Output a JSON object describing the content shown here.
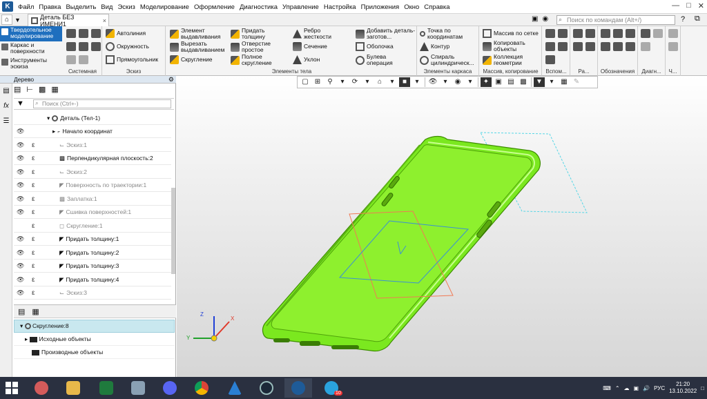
{
  "menu": {
    "items": [
      "Файл",
      "Правка",
      "Выделить",
      "Вид",
      "Эскиз",
      "Моделирование",
      "Оформление",
      "Диагностика",
      "Управление",
      "Настройка",
      "Приложения",
      "Окно",
      "Справка"
    ]
  },
  "tab": {
    "title": "Деталь БЕЗ ИМЕНИ1",
    "close": "×"
  },
  "command_search": {
    "placeholder": "Поиск по командам (Alt+/)"
  },
  "modes": [
    "Твердотельное моделирование",
    "Каркас и поверхности",
    "Инструменты эскиза"
  ],
  "ribbon": {
    "system_label": "Системная",
    "sketch": {
      "label": "Эскиз",
      "b1": "Автолиния",
      "b2": "Окружность",
      "b3": "Прямоугольник"
    },
    "body": {
      "label": "Элементы тела",
      "b1": "Элемент выдавливания",
      "b2": "Вырезать выдавливанием",
      "b3": "Скругление",
      "b4": "Придать толщину",
      "b5": "Отверстие простое",
      "b6": "Полное скругление",
      "b7": "Ребро жесткости",
      "b8": "Сечение",
      "b9": "Уклон",
      "b10": "Добавить деталь-заготов...",
      "b11": "Оболочка",
      "b12": "Булева операция"
    },
    "frame": {
      "label": "Элементы каркаса",
      "b1": "Точка по координатам",
      "b2": "Контур",
      "b3": "Спираль цилиндрическ..."
    },
    "copy": {
      "label": "Массив, копирование",
      "b1": "Массив по сетке",
      "b2": "Копировать объекты",
      "b3": "Коллекция геометрии"
    },
    "aux_label": "Вспом...",
    "size_label": "Ра...",
    "notation_label": "Обозначения",
    "diag_label": "Диагн...",
    "ch_label": "Ч..."
  },
  "tree": {
    "title": "Дерево",
    "search_placeholder": "Поиск (Ctrl+-)",
    "rows": [
      {
        "label": "Деталь (Тел-1)"
      },
      {
        "label": "Начало координат"
      },
      {
        "label": "Эскиз:1"
      },
      {
        "label": "Перпендикулярная плоскость:2"
      },
      {
        "label": "Эскиз:2"
      },
      {
        "label": "Поверхность по траектории:1"
      },
      {
        "label": "Заплатка:1"
      },
      {
        "label": "Сшивка поверхностей:1"
      },
      {
        "label": "Скругление:1"
      },
      {
        "label": "Придать толщину:1"
      },
      {
        "label": "Придать толщину:2"
      },
      {
        "label": "Придать толщину:3"
      },
      {
        "label": "Придать толщину:4"
      },
      {
        "label": "Эскиз:3"
      }
    ]
  },
  "props": {
    "selected": "Скругление:8",
    "source": "Исходные объекты",
    "derived": "Производные объекты"
  },
  "axes": {
    "x": "X",
    "y": "Y",
    "z": "Z"
  },
  "colors": {
    "accent": "#1f6fbe",
    "model": "#7be81f",
    "model_edge": "#3d8d00",
    "taskbar": "#2a3040"
  },
  "taskbar": {
    "badge": "10"
  },
  "tray": {
    "lang": "РУС",
    "time": "21:20",
    "date": "13.10.2022"
  }
}
